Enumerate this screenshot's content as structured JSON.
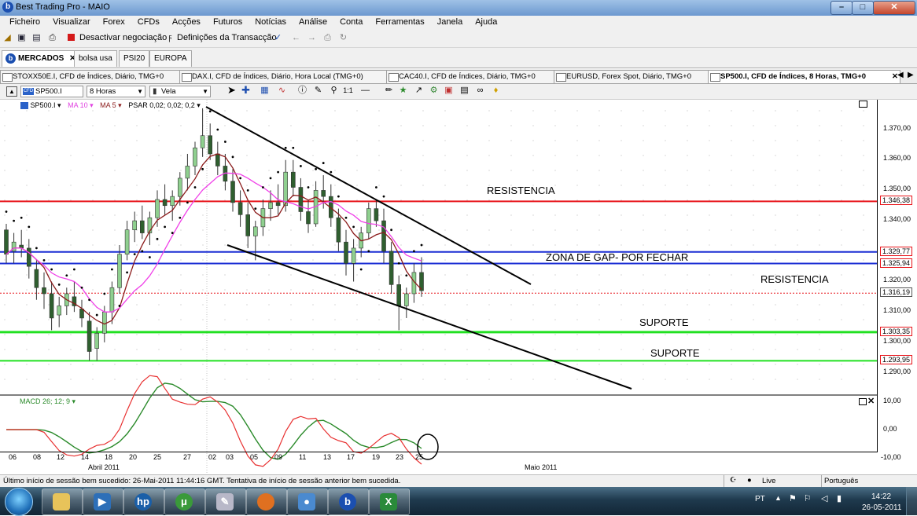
{
  "window": {
    "title": "Best Trading Pro - MAIO",
    "min": "–",
    "max": "□",
    "close": "✕"
  },
  "menu": [
    "Ficheiro",
    "Visualizar",
    "Forex",
    "CFDs",
    "Acções",
    "Futuros",
    "Notícias",
    "Análise",
    "Conta",
    "Ferramentas",
    "Janela",
    "Ajuda"
  ],
  "toolbar": {
    "deactivate": "Desactivar negociação",
    "settings": "Definições da Transacção"
  },
  "workspace_tabs": [
    "MERCADOS",
    "bolsa usa",
    "PSI20",
    "EUROPA"
  ],
  "chart_tabs": [
    "STOXX50E.I, CFD de Índices, Diário, TMG+0",
    "DAX.I, CFD de Índices, Diário, Hora Local (TMG+0)",
    "CAC40.I, CFD de Índices, Diário, TMG+0",
    "EURUSD, Forex Spot, Diário, TMG+0",
    "SP500.I, CFD de Índices, 8 Horas, TMG+0"
  ],
  "chart_toolbar": {
    "symbol": "SP500.I",
    "timeframe": "8 Horas",
    "style": "Vela"
  },
  "indicators": {
    "symbol": "SP500.I ▾",
    "ma10": "MA 10 ▾",
    "ma5": "MA 5 ▾",
    "psar": "PSAR 0,02; 0,02; 0,2 ▾",
    "macd": "MACD 26; 12; 9 ▾"
  },
  "annotations": {
    "resist1": "RESISTENCIA",
    "gap": "ZONA DE GAP- POR FECHAR",
    "resist2": "RESISTENCIA",
    "sup1": "SUPORTE",
    "sup2": "SUPORTE"
  },
  "colors": {
    "red": "#e8141a",
    "blue": "#1c2fd4",
    "green": "#22e022",
    "ma_dark": "#8b1a1a",
    "ma_pink": "#f040e8",
    "macd_green": "#2a8a2a",
    "macd_red": "#e83030"
  },
  "price_axis": {
    "ticks": [
      "1.370,00",
      "1.360,00",
      "1.350,00",
      "1.340,00",
      "1.320,00",
      "1.310,00",
      "1.300,00",
      "1.290,00"
    ],
    "labels": {
      "l1": "1.346,38",
      "l2": "1.329,77",
      "l3": "1.325,94",
      "l4": "1.316,19",
      "l5": "1.303,35",
      "l6": "1.293,95"
    },
    "macd_ticks": [
      "10,00",
      "0,00",
      "-10,00"
    ]
  },
  "time_axis": {
    "days": [
      "06",
      "08",
      "12",
      "14",
      "18",
      "20",
      "25",
      "27",
      "02",
      "03",
      "05",
      "09",
      "11",
      "13",
      "17",
      "19",
      "23",
      "25"
    ],
    "months": [
      "Abril 2011",
      "Maio 2011"
    ]
  },
  "chart_data": {
    "type": "candlestick",
    "ylim": [
      1285,
      1378
    ],
    "candles": [
      [
        1337,
        1339,
        1326,
        1329
      ],
      [
        1330,
        1336,
        1326,
        1333
      ],
      [
        1332,
        1337,
        1328,
        1331
      ],
      [
        1331,
        1334,
        1321,
        1325
      ],
      [
        1324,
        1327,
        1314,
        1318
      ],
      [
        1318,
        1323,
        1311,
        1316
      ],
      [
        1316,
        1320,
        1304,
        1308
      ],
      [
        1309,
        1315,
        1305,
        1312
      ],
      [
        1312,
        1318,
        1309,
        1316
      ],
      [
        1315,
        1320,
        1310,
        1312
      ],
      [
        1311,
        1314,
        1305,
        1308
      ],
      [
        1307,
        1310,
        1294,
        1297
      ],
      [
        1298,
        1305,
        1294,
        1303
      ],
      [
        1303,
        1312,
        1300,
        1310
      ],
      [
        1310,
        1320,
        1306,
        1318
      ],
      [
        1318,
        1332,
        1316,
        1329
      ],
      [
        1329,
        1340,
        1327,
        1337
      ],
      [
        1337,
        1343,
        1333,
        1340
      ],
      [
        1340,
        1345,
        1334,
        1336
      ],
      [
        1336,
        1343,
        1332,
        1341
      ],
      [
        1341,
        1350,
        1338,
        1347
      ],
      [
        1347,
        1352,
        1342,
        1345
      ],
      [
        1345,
        1350,
        1340,
        1348
      ],
      [
        1348,
        1356,
        1345,
        1354
      ],
      [
        1354,
        1362,
        1350,
        1358
      ],
      [
        1358,
        1366,
        1355,
        1364
      ],
      [
        1364,
        1377,
        1361,
        1368
      ],
      [
        1368,
        1372,
        1360,
        1362
      ],
      [
        1362,
        1366,
        1355,
        1358
      ],
      [
        1358,
        1362,
        1350,
        1353
      ],
      [
        1353,
        1357,
        1343,
        1346
      ],
      [
        1346,
        1350,
        1338,
        1342
      ],
      [
        1342,
        1346,
        1331,
        1335
      ],
      [
        1335,
        1340,
        1327,
        1338
      ],
      [
        1338,
        1347,
        1335,
        1344
      ],
      [
        1344,
        1350,
        1340,
        1346
      ],
      [
        1346,
        1352,
        1342,
        1345
      ],
      [
        1345,
        1360,
        1343,
        1356
      ],
      [
        1356,
        1360,
        1348,
        1351
      ],
      [
        1351,
        1354,
        1340,
        1343
      ],
      [
        1343,
        1347,
        1336,
        1339
      ],
      [
        1339,
        1353,
        1338,
        1350
      ],
      [
        1350,
        1355,
        1344,
        1348
      ],
      [
        1348,
        1352,
        1338,
        1341
      ],
      [
        1341,
        1344,
        1330,
        1333
      ],
      [
        1333,
        1337,
        1322,
        1326
      ],
      [
        1326,
        1334,
        1320,
        1331
      ],
      [
        1331,
        1338,
        1328,
        1336
      ],
      [
        1336,
        1346,
        1334,
        1344
      ],
      [
        1344,
        1347,
        1338,
        1340
      ],
      [
        1340,
        1344,
        1326,
        1330
      ],
      [
        1330,
        1333,
        1316,
        1319
      ],
      [
        1319,
        1322,
        1304,
        1312
      ],
      [
        1312,
        1318,
        1308,
        1316
      ],
      [
        1316,
        1326,
        1313,
        1323
      ],
      [
        1323,
        1328,
        1315,
        1317
      ]
    ],
    "lines": {
      "resist": 1346.38,
      "gap_top": 1329.77,
      "gap_bottom": 1325.94,
      "last": 1316.19,
      "sup1": 1303.35,
      "sup2": 1293.95
    }
  },
  "status": {
    "message": "Último início de sessão bem sucedido: 26-Mai-2011 11:44:16 GMT. Tentativa de início de sessão anterior bem sucedida.",
    "live": "Live",
    "lang": "Português"
  },
  "taskbar": {
    "lang": "PT",
    "time": "14:22",
    "date": "26-05-2011"
  }
}
